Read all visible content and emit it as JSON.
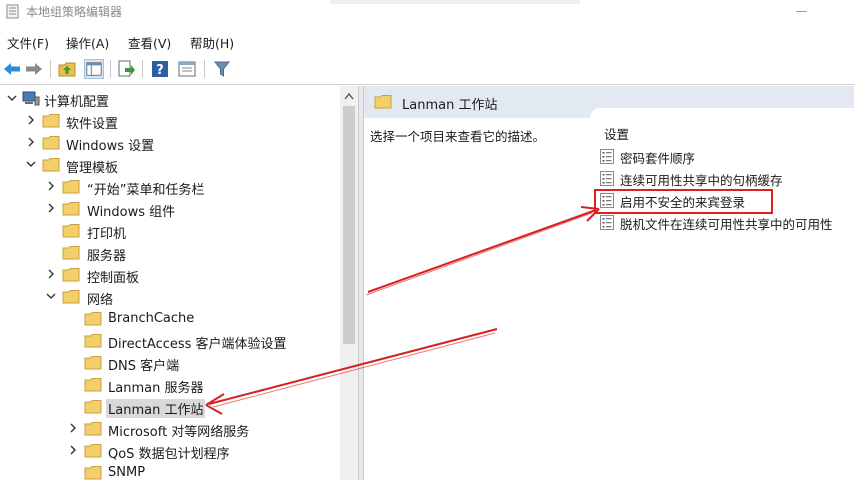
{
  "window": {
    "title": "本地组策略编辑器",
    "app_icon": "policy-editor-icon"
  },
  "menu": {
    "file": "文件(F)",
    "action": "操作(A)",
    "view": "查看(V)",
    "help": "帮助(H)"
  },
  "toolbar": {
    "icons": [
      "back-arrow-icon",
      "forward-arrow-icon",
      "up-folder-icon",
      "show-hide-tree-icon",
      "export-list-icon",
      "help-icon",
      "properties-icon",
      "filter-icon"
    ]
  },
  "tree": {
    "root": "计算机配置",
    "software_settings": "软件设置",
    "windows_settings": "Windows 设置",
    "admin_templates": "管理模板",
    "start_menu": "“开始”菜单和任务栏",
    "windows_components": "Windows 组件",
    "printers": "打印机",
    "server": "服务器",
    "control_panel": "控制面板",
    "network": "网络",
    "branchcache": "BranchCache",
    "directaccess": "DirectAccess 客户端体验设置",
    "dns_client": "DNS 客户端",
    "lanman_server": "Lanman 服务器",
    "lanman_workstation": "Lanman 工作站",
    "microsoft_p2p": "Microsoft 对等网络服务",
    "qos": "QoS 数据包计划程序",
    "snmp": "SNMP"
  },
  "details": {
    "header_title": "Lanman 工作站",
    "description": "选择一个项目来查看它的描述。",
    "column_header": "设置",
    "settings": [
      "密码套件顺序",
      "连续可用性共享中的句柄缓存",
      "启用不安全的来宾登录",
      "脱机文件在连续可用性共享中的可用性"
    ]
  },
  "colors": {
    "annotation": "#e02020",
    "folder": "#f2cf6b",
    "header_bg": "#e3e9f0",
    "selection": "#d9d9d9"
  }
}
